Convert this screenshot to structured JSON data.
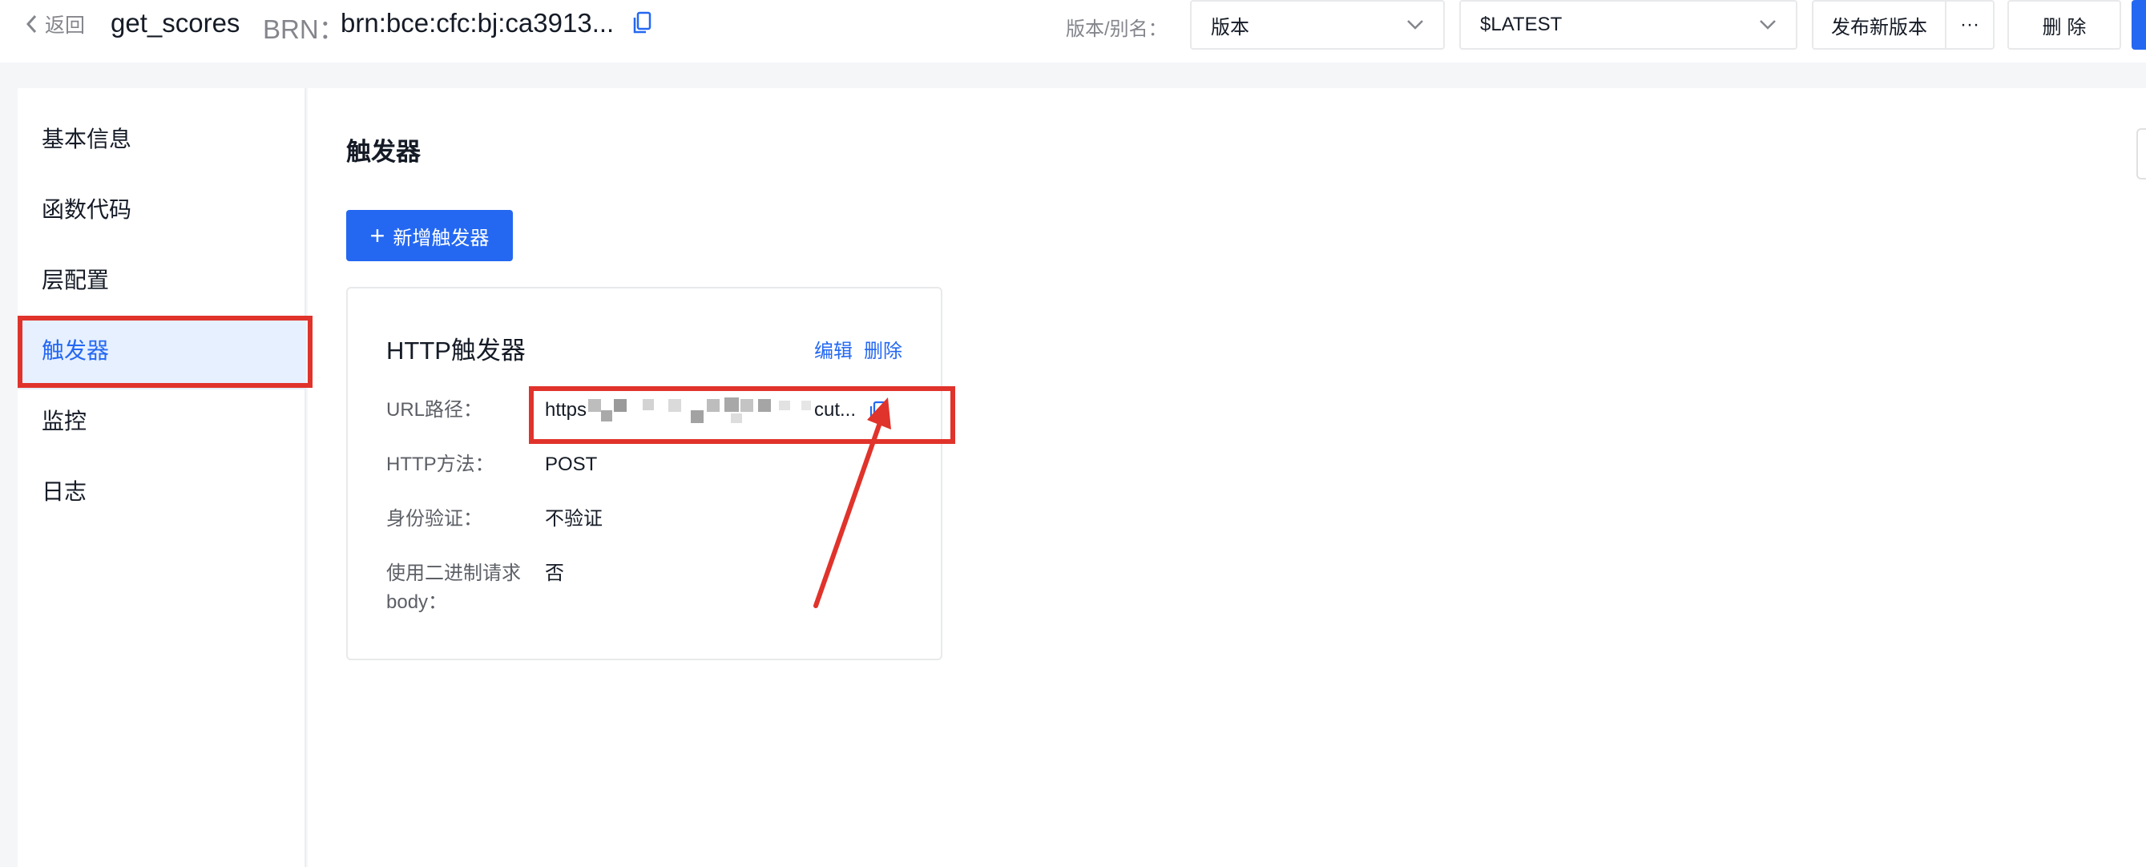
{
  "header": {
    "back_label": "返回",
    "function_name": "get_scores",
    "brn_label": "BRN：",
    "brn_value": "brn:bce:cfc:bj:ca3913...",
    "version_alias_label": "版本/别名：",
    "version_select": "版本",
    "alias_select": "$LATEST",
    "publish_button": "发布新版本",
    "more_button": "···",
    "delete_button": "删 除"
  },
  "sidebar": {
    "items": [
      {
        "label": "基本信息",
        "active": false
      },
      {
        "label": "函数代码",
        "active": false
      },
      {
        "label": "层配置",
        "active": false
      },
      {
        "label": "触发器",
        "active": true
      },
      {
        "label": "监控",
        "active": false
      },
      {
        "label": "日志",
        "active": false
      }
    ]
  },
  "main": {
    "title": "触发器",
    "add_button": "新增触发器",
    "trigger_card": {
      "title": "HTTP触发器",
      "edit_link": "编辑",
      "delete_link": "删除",
      "fields": [
        {
          "label": "URL路径：",
          "value_start": "https",
          "value_end": "cut..."
        },
        {
          "label": "HTTP方法：",
          "value": "POST"
        },
        {
          "label": "身份验证：",
          "value": "不验证"
        },
        {
          "label_line1": "使用二进制请求",
          "label_line2": "body：",
          "value": "否"
        }
      ]
    }
  },
  "colors": {
    "accent": "#2468f2",
    "annotation": "#e0332b",
    "active_bg": "#e6f0ff"
  },
  "icons": [
    "chevron-left-icon",
    "copy-icon",
    "chevron-down-icon",
    "plus-icon"
  ]
}
